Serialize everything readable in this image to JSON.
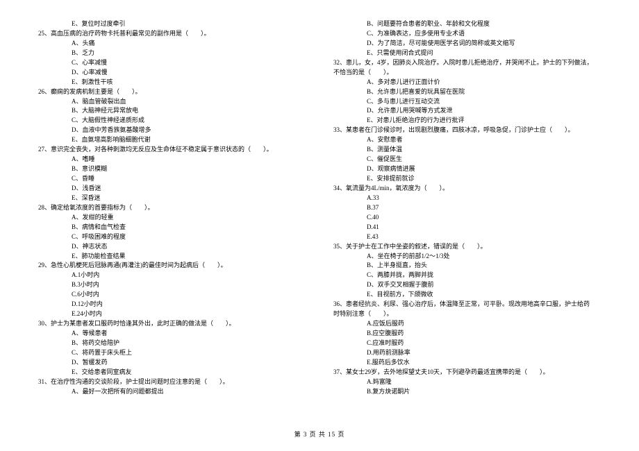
{
  "footer": "第 3 页 共 15 页",
  "left": {
    "q24_optE": "E、复位时过度牵引",
    "q25": {
      "stem": "25、高血压病的治疗药物卡托普利最常见的副作用是（　　）。",
      "A": "A、头痛",
      "B": "B、乏力",
      "C": "C、心率减慢",
      "D": "D、心率减慢",
      "E": "E、刺激性干咳"
    },
    "q26": {
      "stem": "26、癫痫的发病机制主要是（　　）。",
      "A": "A、脑血管破裂出血",
      "B": "B、大脑神经元异常放电",
      "C": "C、大脑假性神经递质形成",
      "D": "D、血液中芳香族氨基酸增多",
      "E": "E、血氨增高影响脑细胞代谢"
    },
    "q27": {
      "stem": "27、意识完全丧失，对各种刺激均无反应及生命体征不稳定属于意识状态的（　　）。",
      "A": "A、嗜睡",
      "B": "B、意识模糊",
      "C": "C、昏睡",
      "D": "D、浅昏迷",
      "E": "E、深昏迷"
    },
    "q28": {
      "stem": "28、确定给氧浓度的首要指标为（　　）。",
      "A": "A、发绀的轻重",
      "B": "B、病情和血气检查",
      "C": "C、呼吸困难的程度",
      "D": "D、神志状态",
      "E": "E、肺功能检查结果"
    },
    "q29": {
      "stem": "29、急性心肌梗死后冠脉再通(再灌注)的最佳时间为起病后（　　）。",
      "A": "A.1小时内",
      "B": "B.3小时内",
      "C": "C.6小时内",
      "D": "D.12小时内",
      "E": "E.24小时内"
    },
    "q30": {
      "stem": "30、护士为某患者发口服药时恰逢其外出，此时正确的做法是（　　）。",
      "A": "A、等候患者",
      "B": "B、将药交给陪护",
      "C": "C、将药置于床头柜上",
      "D": "D、暂缓发药",
      "E": "E、交给患者同室病友"
    },
    "q31": {
      "stem": "31、在治疗性沟通的交谈阶段，护士提出问题时应注意的是（　　）。",
      "A": "A、最好一次把所有的问题都提出"
    }
  },
  "right": {
    "q31_cont": {
      "B": "B、问题要符合患者的职业、年龄和文化程度",
      "C": "C、为准确表达，应多使用专业术语",
      "D": "D、为了简洁，尽可能使用医学名词的简称或英文缩写",
      "E": "E、只需使用闭合式提问"
    },
    "q32": {
      "stem": "32、患儿，女，4岁，因肺炎入院治疗。入院时患儿拒绝治疗，并哭闹不止。护士的下列做法，",
      "stem2": "不恰当的是（　　）。",
      "A": "A、多对患儿进行正面计价",
      "B": "B、允许患儿把喜爱的玩具留在医院",
      "C": "C、多与患儿进行互动交流",
      "D": "D、允许患儿用哭喊等方式发泄",
      "E": "E、对患儿拒绝治疗的行为进行批评"
    },
    "q33": {
      "stem": "33、某患者在门诊候诊时，出现剧烈腹痛，四肢冰凉，呼吸急促，门诊护士应（　　）。",
      "A": "A、安慰患者",
      "B": "B、测量体温",
      "C": "C、催促医生",
      "D": "D、观察病情进展",
      "E": "E、安排提前就诊"
    },
    "q34": {
      "stem": "34、氧流量为4L/min，氧浓度为（　　）。",
      "A": "A.33",
      "B": "B.37",
      "C": "C.40",
      "D": "D.41",
      "E": "E.43"
    },
    "q35": {
      "stem": "35、关于护士在工作中坐姿的叙述，错误的是（　　）。",
      "A": "A、坐在椅子的前部1/2～1/3处",
      "B": "B、上半身挺直，抬头",
      "C": "C、两膝并拢，两脚并拢",
      "D": "D、双手交叉相握于腹前",
      "E": "E、目视前方，下颌微收"
    },
    "q36": {
      "stem": "36、患者经抗炎、利尿、强心治疗后，体温降至正常，可平卧。现改用地高辛口服，护士给药",
      "stem2": "时特别注意（　　）。",
      "A": "A.应饭后服药",
      "B": "B.应空腹服药",
      "C": "C.应准时服药",
      "D": "D.用药前测脉率",
      "E": "E.服药后多饮水"
    },
    "q37": {
      "stem": "37、某女士29岁，去外地探望丈夫10天，下列避孕药最适宜携带的是（　　）。",
      "A": "A.妈富隆",
      "B": "B.复方炔诺酮片"
    }
  }
}
